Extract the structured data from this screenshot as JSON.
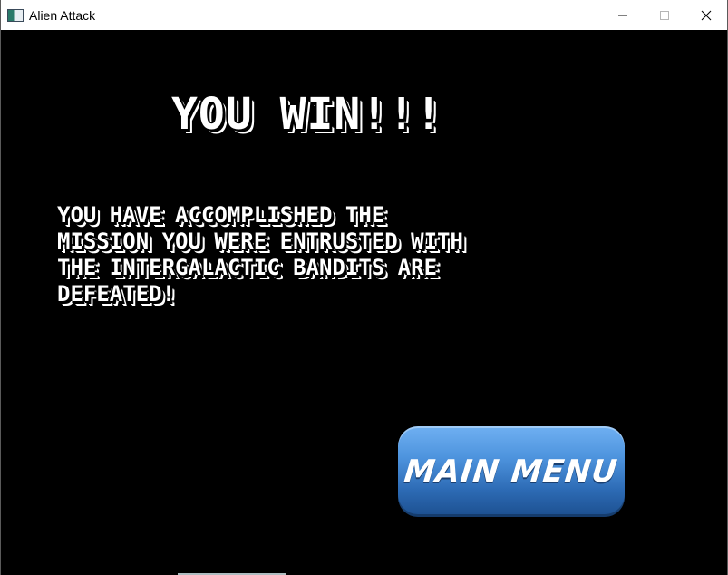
{
  "window": {
    "title": "Alien Attack",
    "controls": {
      "minimize": "minimize-icon",
      "maximize": "maximize-icon",
      "close": "close-icon"
    }
  },
  "screen": {
    "headline": "YOU WIN!!!",
    "message_lines": [
      "YOU HAVE ACCOMPLISHED THE",
      "MISSION YOU WERE ENTRUSTED WITH",
      "THE INTERGALACTIC BANDITS ARE",
      "DEFEATED!"
    ],
    "main_menu_button": "MAIN MENU",
    "colors": {
      "background": "#000000",
      "text": "#ffffff",
      "button_top": "#6fb0f2",
      "button_bottom": "#1c4f8f"
    }
  }
}
